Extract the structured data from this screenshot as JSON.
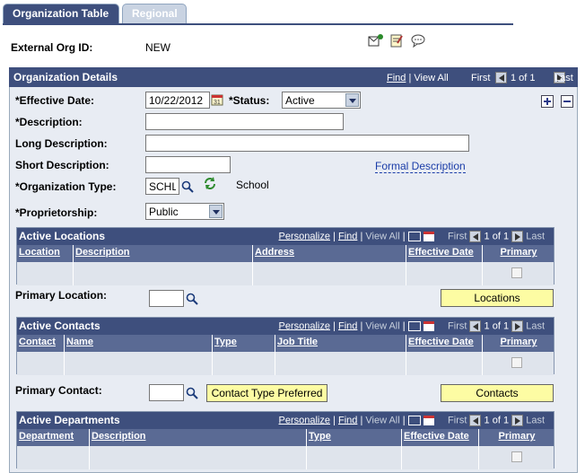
{
  "tabs": [
    {
      "label": "Organization Table",
      "active": true
    },
    {
      "label": "Regional",
      "active": false
    }
  ],
  "header": {
    "ext_id_label": "External Org ID:",
    "ext_id_value": "NEW"
  },
  "section": {
    "title": "Organization Details",
    "nav": {
      "find": "Find",
      "view_all": "View All",
      "first": "First",
      "count": "1 of 1",
      "last": "Last"
    }
  },
  "form": {
    "effective_date_label": "*Effective Date:",
    "effective_date_value": "10/22/2012",
    "status_label": "*Status:",
    "status_value": "Active",
    "description_label": "*Description:",
    "description_value": "",
    "long_desc_label": "Long Description:",
    "long_desc_value": "",
    "short_desc_label": "Short Description:",
    "short_desc_value": "",
    "formal_desc_link": "Formal Description",
    "org_type_label": "*Organization Type:",
    "org_type_value": "SCHL",
    "org_type_desc": "School",
    "proprietorship_label": "*Proprietorship:",
    "proprietorship_value": "Public",
    "primary_location_label": "Primary Location:",
    "primary_location_value": "",
    "locations_button": "Locations",
    "primary_contact_label": "Primary Contact:",
    "primary_contact_value": "",
    "contact_type_button": "Contact Type Preferred",
    "contacts_button": "Contacts"
  },
  "grid_nav": {
    "personalize": "Personalize",
    "find": "Find",
    "view_all": "View All",
    "first": "First",
    "count": "1 of 1",
    "last": "Last"
  },
  "grids": {
    "locations": {
      "title": "Active Locations",
      "columns": [
        "Location",
        "Description",
        "Address",
        "Effective Date",
        "Primary"
      ]
    },
    "contacts": {
      "title": "Active Contacts",
      "columns": [
        "Contact",
        "Name",
        "Type",
        "Job Title",
        "Effective Date",
        "Primary"
      ]
    },
    "departments": {
      "title": "Active Departments",
      "columns": [
        "Department",
        "Description",
        "Type",
        "Effective Date",
        "Primary"
      ]
    }
  },
  "colors": {
    "header_bg": "#3e4f7d",
    "column_bg": "#5a6a94",
    "section_bg": "#e8ecf3",
    "button_yellow": "#fdfca3"
  }
}
